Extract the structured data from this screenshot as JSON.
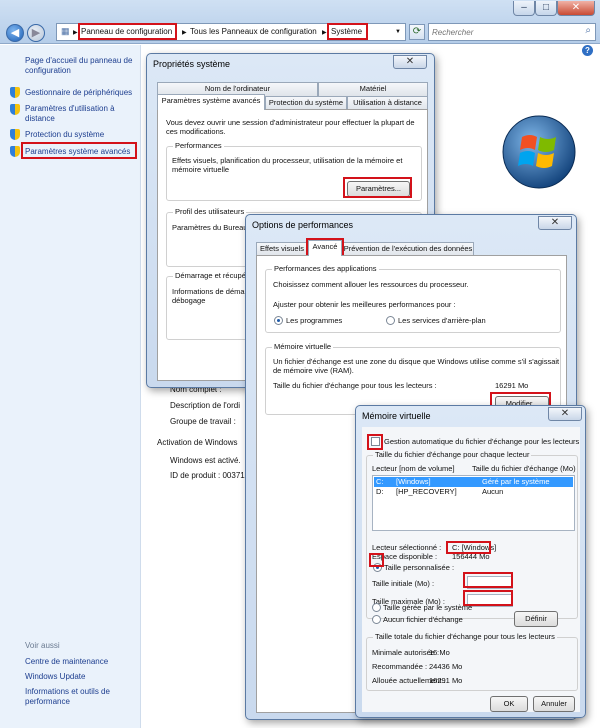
{
  "explorer": {
    "breadcrumb": [
      "Panneau de configuration",
      "Tous les Panneaux de configuration",
      "Système"
    ],
    "search_placeholder": "Rechercher",
    "help": "?"
  },
  "sidebar": {
    "home": "Page d'accueil du panneau de configuration",
    "items": [
      "Gestionnaire de périphériques",
      "Paramètres d'utilisation à distance",
      "Protection du système",
      "Paramètres système avancés"
    ],
    "see_also": "Voir aussi",
    "links": [
      "Centre de maintenance",
      "Windows Update",
      "Informations et outils de performance"
    ]
  },
  "main": {
    "rows": [
      "Nom complet :",
      "Description de l'ordi",
      "Groupe de travail :"
    ],
    "activation_heading": "Activation de Windows",
    "activated": "Windows est activé.",
    "product_id": "ID de produit : 00371"
  },
  "sysprops": {
    "title": "Propriétés système",
    "tabs_back": [
      "Nom de l'ordinateur",
      "Matériel"
    ],
    "tabs_front": [
      "Paramètres système avancés",
      "Protection du système",
      "Utilisation à distance"
    ],
    "intro": [
      "Vous devez ouvrir une session d'administrateur pour effectuer la plupart de",
      "ces modifications."
    ],
    "perf_label": "Performances",
    "perf_desc": [
      "Effets visuels, planification du processeur, utilisation de la mémoire et",
      "mémoire virtuelle"
    ],
    "perf_button": "Paramètres...",
    "profiles_label": "Profil des utilisateurs",
    "profiles_desc": "Paramètres du Bureau",
    "startup_label": "Démarrage et récupéra",
    "startup_desc": [
      "Informations de démar",
      "débogage"
    ]
  },
  "perfopts": {
    "title": "Options de performances",
    "tabs": [
      "Effets visuels",
      "Avancé",
      "Prévention de l'exécution des données"
    ],
    "app_perf_label": "Performances des applications",
    "app_perf_desc": "Choisissez comment allouer les ressources du processeur.",
    "adjust_label": "Ajuster pour obtenir les meilleures performances pour :",
    "radio_programs": "Les programmes",
    "radio_services": "Les services d'arrière-plan",
    "vm_label": "Mémoire virtuelle",
    "vm_desc": [
      "Un fichier d'échange est une zone du disque que Windows utilise comme s'il s'agissait",
      "de mémoire vive (RAM)."
    ],
    "vm_total_label": "Taille du fichier d'échange pour tous les lecteurs :",
    "vm_total_value": "16291 Mo",
    "modify_button": "Modifier..."
  },
  "virtmem": {
    "title": "Mémoire virtuelle",
    "auto_label": "Gestion automatique du fichier d'échange pour les lecteurs",
    "per_drive_label": "Taille du fichier d'échange pour chaque lecteur",
    "col_drive": "Lecteur [nom de volume]",
    "col_size": "Taille du fichier d'échange (Mo)",
    "drives": [
      {
        "drive": "C:",
        "volume": "[Windows]",
        "size": "Géré par le système"
      },
      {
        "drive": "D:",
        "volume": "[HP_RECOVERY]",
        "size": "Aucun"
      }
    ],
    "selected_label": "Lecteur sélectionné :",
    "selected_value": "C:  [Windows]",
    "free_label": "Espace disponible :",
    "free_value": "156444 Mo",
    "custom_label": "Taille personnalisée :",
    "initial_label": "Taille initiale (Mo) :",
    "max_label": "Taille maximale (Mo) :",
    "system_managed_label": "Taille gérée par le système",
    "no_file_label": "Aucun fichier d'échange",
    "define_button": "Définir",
    "total_label": "Taille totale du fichier d'échange pour tous les lecteurs",
    "min_label": "Minimale autorisée :",
    "min_value": "16 Mo",
    "rec_label": "Recommandée :",
    "rec_value": "24436 Mo",
    "alloc_label": "Allouée actuellement :",
    "alloc_value": "16291 Mo",
    "ok_button": "OK",
    "cancel_button": "Annuler"
  },
  "icons": [
    "back-arrow-icon",
    "forward-arrow-icon",
    "refresh-icon",
    "search-icon",
    "shield-icon",
    "windows-logo-icon",
    "close-icon",
    "help-icon"
  ],
  "colors": {
    "highlight": "#d3121a",
    "link": "#1d3e8f",
    "sidebar": "#eaf2fb",
    "selection": "#3399ff"
  }
}
